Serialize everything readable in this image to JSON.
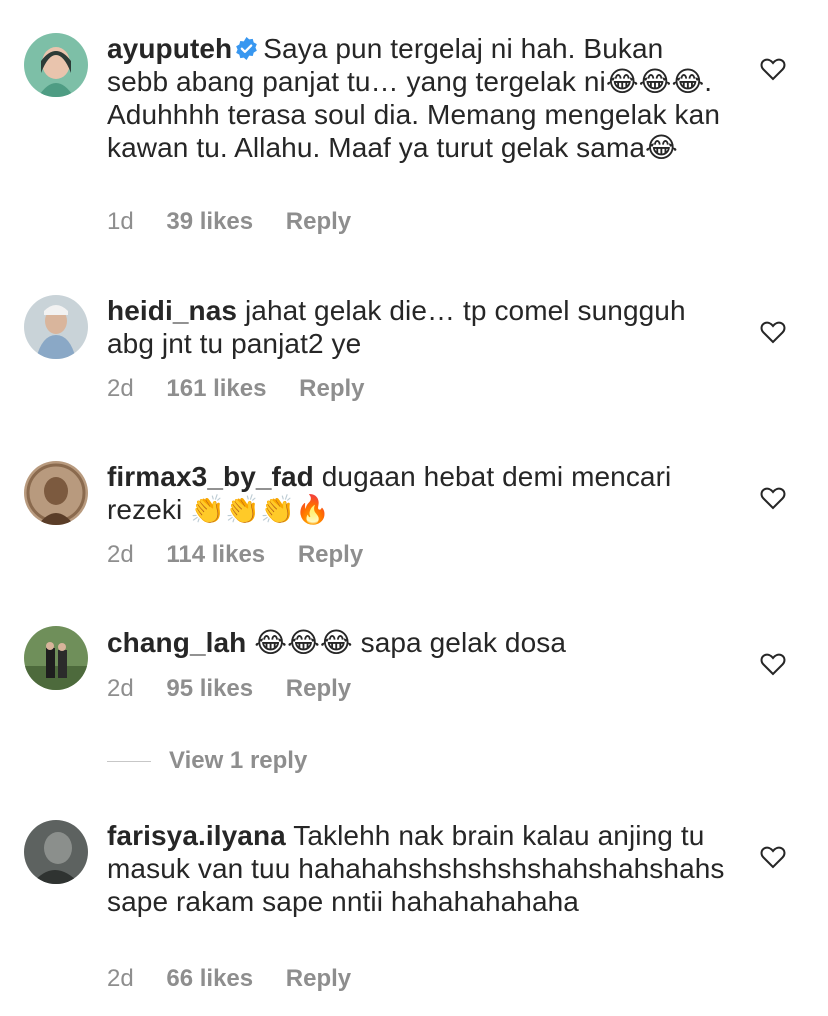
{
  "comments": [
    {
      "username": "ayuputeh",
      "verified": true,
      "text": "Saya pun tergelaj ni hah. Bukan sebb abang panjat tu… yang tergelak ni😂😂😂. Aduhhhh terasa soul dia. Memang mengelak kan kawan tu. Allahu. Maaf ya turut gelak sama😂",
      "time": "1d",
      "likes": "39 likes",
      "reply": "Reply"
    },
    {
      "username": "heidi_nas",
      "verified": false,
      "text": "jahat gelak die… tp comel sungguh abg jnt tu panjat2 ye",
      "time": "2d",
      "likes": "161 likes",
      "reply": "Reply"
    },
    {
      "username": "firmax3_by_fad",
      "verified": false,
      "text": "dugaan hebat demi mencari rezeki 👏👏👏🔥",
      "time": "2d",
      "likes": "114 likes",
      "reply": "Reply"
    },
    {
      "username": "chang_lah",
      "verified": false,
      "text": "😂😂😂 sapa gelak dosa",
      "time": "2d",
      "likes": "95 likes",
      "reply": "Reply"
    },
    {
      "username": "farisya.ilyana",
      "verified": false,
      "text": "Taklehh nak brain kalau anjing tu masuk van tuu hahahahshshshshshahshahshahs sape rakam sape nntii hahahahahaha",
      "time": "2d",
      "likes": "66 likes",
      "reply": "Reply"
    }
  ],
  "view_replies": "View 1 reply",
  "icons": {
    "like": "heart-outline-icon",
    "verified": "verified-badge-icon"
  },
  "colors": {
    "text": "#262626",
    "meta": "#8e8e8e",
    "verified": "#3897f0"
  }
}
